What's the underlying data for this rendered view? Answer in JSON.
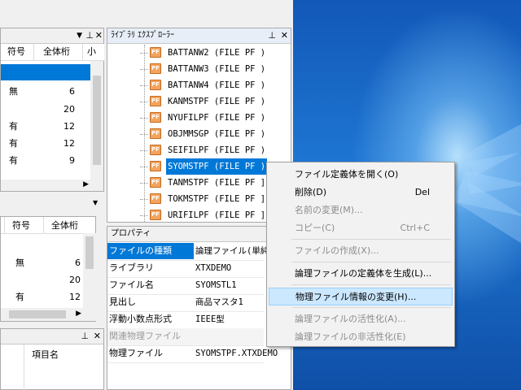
{
  "top_left_grid": {
    "headers": [
      "符号",
      "全体桁",
      "小"
    ],
    "rows": [
      {
        "sign": "",
        "total": ""
      },
      {
        "sign": "無",
        "total": "6"
      },
      {
        "sign": "",
        "total": "20"
      },
      {
        "sign": "有",
        "total": "12"
      },
      {
        "sign": "有",
        "total": "12"
      },
      {
        "sign": "有",
        "total": "9"
      }
    ]
  },
  "mid_left_grid": {
    "headers": [
      "符号",
      "全体桁"
    ],
    "rows": [
      {
        "sign": "無",
        "total": "6"
      },
      {
        "sign": "",
        "total": "20"
      },
      {
        "sign": "有",
        "total": "12"
      }
    ]
  },
  "bottom_left": {
    "pin_icon": "pin-icon",
    "header": "項目名"
  },
  "library_explorer": {
    "title": "ﾗｲﾌﾞﾗﾘ ｴｸｽﾌﾟﾛｰﾗｰ",
    "icon_label": "PF",
    "items": [
      "BATTANW2 (FILE PF )",
      "BATTANW3 (FILE PF )",
      "BATTANW4 (FILE PF )",
      "KANMSTPF (FILE PF )",
      "NYUFILPF (FILE PF )",
      "OBJMMSGP (FILE PF )",
      "SEIFILPF (FILE PF )",
      "SYOMSTPF (FILE PF )",
      "TANMSTPF (FILE PF ]",
      "TOKMSTPF (FILE PF ]",
      "URIFILPF (FILE PF ]"
    ],
    "selected_index": 7
  },
  "properties": {
    "title": "プロパティ",
    "rows": [
      {
        "key": "ファイルの種類",
        "value": "論理ファイル(単純"
      },
      {
        "key": "ライブラリ",
        "value": "XTXDEMO"
      },
      {
        "key": "ファイル名",
        "value": "SYOMSTL1"
      },
      {
        "key": "見出し",
        "value": "商品マスタ1"
      },
      {
        "key": "浮動小数点形式",
        "value": "IEEE型"
      },
      {
        "key": "関連物理ファイル",
        "value": ""
      },
      {
        "key": "物理ファイル",
        "value": "SYOMSTPF.XTXDEMO"
      }
    ]
  },
  "context_menu": {
    "items": [
      {
        "label": "ファイル定義体を開く(O)",
        "shortcut": "",
        "disabled": false
      },
      {
        "label": "削除(D)",
        "shortcut": "Del",
        "disabled": false
      },
      {
        "label": "名前の変更(M)...",
        "shortcut": "",
        "disabled": true
      },
      {
        "label": "コピー(C)",
        "shortcut": "Ctrl+C",
        "disabled": true
      },
      {
        "label": "ファイルの作成(X)...",
        "shortcut": "",
        "disabled": true
      },
      {
        "label": "論理ファイルの定義体を生成(L)...",
        "shortcut": "",
        "disabled": false
      },
      {
        "label": "物理ファイル情報の変更(H)...",
        "shortcut": "",
        "disabled": false,
        "highlighted": true
      },
      {
        "label": "論理ファイルの活性化(A)...",
        "shortcut": "",
        "disabled": true
      },
      {
        "label": "論理ファイルの非活性化(E)",
        "shortcut": "",
        "disabled": true
      }
    ]
  },
  "colors": {
    "selection": "#0078d7",
    "menu_highlight": "#cce8ff",
    "desktop": "#1f78d4"
  }
}
